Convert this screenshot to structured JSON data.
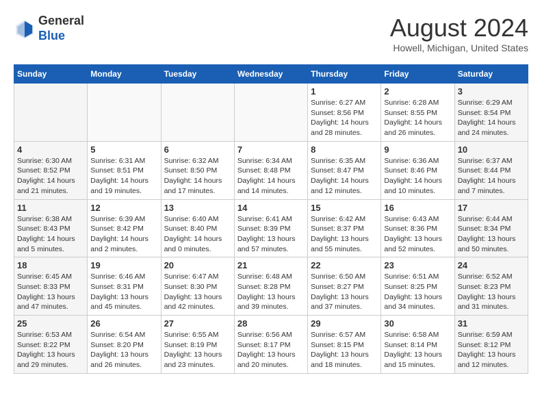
{
  "header": {
    "logo_line1": "General",
    "logo_line2": "Blue",
    "month_year": "August 2024",
    "location": "Howell, Michigan, United States"
  },
  "calendar": {
    "days_of_week": [
      "Sunday",
      "Monday",
      "Tuesday",
      "Wednesday",
      "Thursday",
      "Friday",
      "Saturday"
    ],
    "weeks": [
      [
        {
          "day": "",
          "info": ""
        },
        {
          "day": "",
          "info": ""
        },
        {
          "day": "",
          "info": ""
        },
        {
          "day": "",
          "info": ""
        },
        {
          "day": "1",
          "info": "Sunrise: 6:27 AM\nSunset: 8:56 PM\nDaylight: 14 hours and 28 minutes."
        },
        {
          "day": "2",
          "info": "Sunrise: 6:28 AM\nSunset: 8:55 PM\nDaylight: 14 hours and 26 minutes."
        },
        {
          "day": "3",
          "info": "Sunrise: 6:29 AM\nSunset: 8:54 PM\nDaylight: 14 hours and 24 minutes."
        }
      ],
      [
        {
          "day": "4",
          "info": "Sunrise: 6:30 AM\nSunset: 8:52 PM\nDaylight: 14 hours and 21 minutes."
        },
        {
          "day": "5",
          "info": "Sunrise: 6:31 AM\nSunset: 8:51 PM\nDaylight: 14 hours and 19 minutes."
        },
        {
          "day": "6",
          "info": "Sunrise: 6:32 AM\nSunset: 8:50 PM\nDaylight: 14 hours and 17 minutes."
        },
        {
          "day": "7",
          "info": "Sunrise: 6:34 AM\nSunset: 8:48 PM\nDaylight: 14 hours and 14 minutes."
        },
        {
          "day": "8",
          "info": "Sunrise: 6:35 AM\nSunset: 8:47 PM\nDaylight: 14 hours and 12 minutes."
        },
        {
          "day": "9",
          "info": "Sunrise: 6:36 AM\nSunset: 8:46 PM\nDaylight: 14 hours and 10 minutes."
        },
        {
          "day": "10",
          "info": "Sunrise: 6:37 AM\nSunset: 8:44 PM\nDaylight: 14 hours and 7 minutes."
        }
      ],
      [
        {
          "day": "11",
          "info": "Sunrise: 6:38 AM\nSunset: 8:43 PM\nDaylight: 14 hours and 5 minutes."
        },
        {
          "day": "12",
          "info": "Sunrise: 6:39 AM\nSunset: 8:42 PM\nDaylight: 14 hours and 2 minutes."
        },
        {
          "day": "13",
          "info": "Sunrise: 6:40 AM\nSunset: 8:40 PM\nDaylight: 14 hours and 0 minutes."
        },
        {
          "day": "14",
          "info": "Sunrise: 6:41 AM\nSunset: 8:39 PM\nDaylight: 13 hours and 57 minutes."
        },
        {
          "day": "15",
          "info": "Sunrise: 6:42 AM\nSunset: 8:37 PM\nDaylight: 13 hours and 55 minutes."
        },
        {
          "day": "16",
          "info": "Sunrise: 6:43 AM\nSunset: 8:36 PM\nDaylight: 13 hours and 52 minutes."
        },
        {
          "day": "17",
          "info": "Sunrise: 6:44 AM\nSunset: 8:34 PM\nDaylight: 13 hours and 50 minutes."
        }
      ],
      [
        {
          "day": "18",
          "info": "Sunrise: 6:45 AM\nSunset: 8:33 PM\nDaylight: 13 hours and 47 minutes."
        },
        {
          "day": "19",
          "info": "Sunrise: 6:46 AM\nSunset: 8:31 PM\nDaylight: 13 hours and 45 minutes."
        },
        {
          "day": "20",
          "info": "Sunrise: 6:47 AM\nSunset: 8:30 PM\nDaylight: 13 hours and 42 minutes."
        },
        {
          "day": "21",
          "info": "Sunrise: 6:48 AM\nSunset: 8:28 PM\nDaylight: 13 hours and 39 minutes."
        },
        {
          "day": "22",
          "info": "Sunrise: 6:50 AM\nSunset: 8:27 PM\nDaylight: 13 hours and 37 minutes."
        },
        {
          "day": "23",
          "info": "Sunrise: 6:51 AM\nSunset: 8:25 PM\nDaylight: 13 hours and 34 minutes."
        },
        {
          "day": "24",
          "info": "Sunrise: 6:52 AM\nSunset: 8:23 PM\nDaylight: 13 hours and 31 minutes."
        }
      ],
      [
        {
          "day": "25",
          "info": "Sunrise: 6:53 AM\nSunset: 8:22 PM\nDaylight: 13 hours and 29 minutes."
        },
        {
          "day": "26",
          "info": "Sunrise: 6:54 AM\nSunset: 8:20 PM\nDaylight: 13 hours and 26 minutes."
        },
        {
          "day": "27",
          "info": "Sunrise: 6:55 AM\nSunset: 8:19 PM\nDaylight: 13 hours and 23 minutes."
        },
        {
          "day": "28",
          "info": "Sunrise: 6:56 AM\nSunset: 8:17 PM\nDaylight: 13 hours and 20 minutes."
        },
        {
          "day": "29",
          "info": "Sunrise: 6:57 AM\nSunset: 8:15 PM\nDaylight: 13 hours and 18 minutes."
        },
        {
          "day": "30",
          "info": "Sunrise: 6:58 AM\nSunset: 8:14 PM\nDaylight: 13 hours and 15 minutes."
        },
        {
          "day": "31",
          "info": "Sunrise: 6:59 AM\nSunset: 8:12 PM\nDaylight: 13 hours and 12 minutes."
        }
      ]
    ]
  }
}
